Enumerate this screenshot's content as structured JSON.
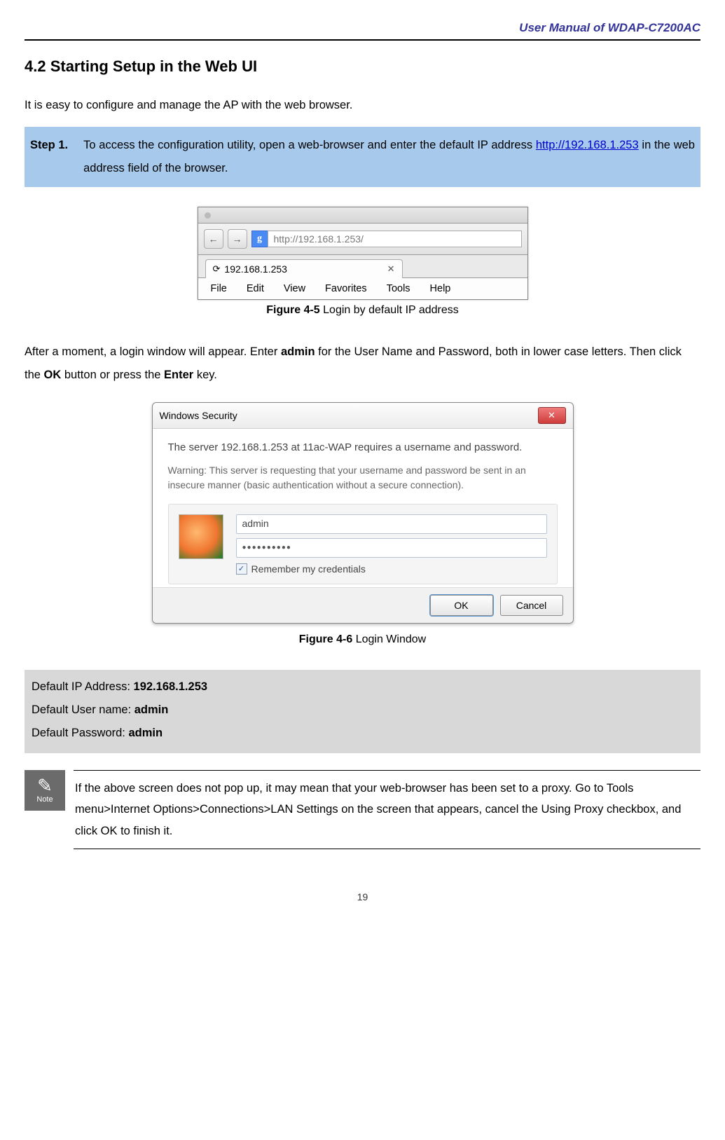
{
  "header": {
    "title": "User Manual of WDAP-C7200AC"
  },
  "section": {
    "heading": "4.2   Starting Setup in the Web UI"
  },
  "intro": "It is easy to configure and manage the AP with the web browser.",
  "step1": {
    "label": "Step 1.",
    "text_a": "To access the configuration utility, open a web-browser and enter the default IP address ",
    "link": "http://192.168.1.253",
    "text_b": " in the web address field of the browser."
  },
  "browser": {
    "g": "g",
    "address": "http://192.168.1.253/",
    "tab": "192.168.1.253",
    "menu": [
      "File",
      "Edit",
      "View",
      "Favorites",
      "Tools",
      "Help"
    ]
  },
  "figure45": {
    "label": "Figure 4-5",
    "caption": " Login by default IP address"
  },
  "para2_a": "After a moment, a login window will appear. Enter ",
  "para2_b": "admin",
  "para2_c": " for the User Name and Password, both in lower case letters. Then click the ",
  "para2_d": "OK",
  "para2_e": " button or press the ",
  "para2_f": "Enter",
  "para2_g": " key.",
  "dialog": {
    "title": "Windows Security",
    "msg": "The server 192.168.1.253 at 11ac-WAP requires a username and password.",
    "warn": "Warning: This server is requesting that your username and password be sent in an insecure manner (basic authentication without a secure connection).",
    "user": "admin",
    "pwd": "●●●●●●●●●●",
    "remember": "Remember my credentials",
    "ok": "OK",
    "cancel": "Cancel"
  },
  "figure46": {
    "label": "Figure 4-6",
    "caption": " Login Window"
  },
  "defaults": {
    "ip_label": "Default IP Address: ",
    "ip_value": "192.168.1.253",
    "user_label": "Default User name: ",
    "user_value": "admin",
    "pass_label": "Default Password: ",
    "pass_value": "admin"
  },
  "note": {
    "icon_label": "Note",
    "text": "If the above screen does not pop up, it may mean that your web-browser has been set to a proxy. Go to Tools menu>Internet Options>Connections>LAN Settings on the screen that appears, cancel the Using Proxy checkbox, and click OK to finish it."
  },
  "page_number": "19"
}
